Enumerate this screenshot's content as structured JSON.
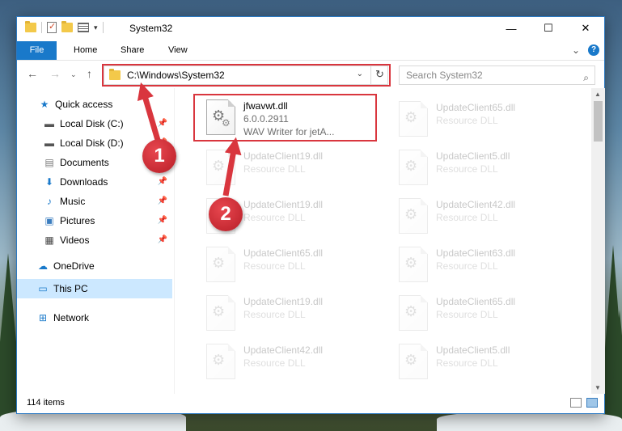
{
  "window": {
    "title": "System32",
    "controls": {
      "minimize": "—",
      "maximize": "☐",
      "close": "✕"
    }
  },
  "ribbon": {
    "tabs": [
      "File",
      "Home",
      "Share",
      "View"
    ],
    "expand": "⌄",
    "help": "?"
  },
  "address": {
    "path": "C:\\Windows\\System32",
    "search_placeholder": "Search System32"
  },
  "sidebar": {
    "items": [
      {
        "label": "Quick access",
        "icon": "star-icon"
      },
      {
        "label": "Local Disk (C:)",
        "icon": "drive-icon"
      },
      {
        "label": "Local Disk (D:)",
        "icon": "drive-icon"
      },
      {
        "label": "Documents",
        "icon": "document-icon"
      },
      {
        "label": "Downloads",
        "icon": "download-icon"
      },
      {
        "label": "Music",
        "icon": "music-icon"
      },
      {
        "label": "Pictures",
        "icon": "pictures-icon"
      },
      {
        "label": "Videos",
        "icon": "video-icon"
      },
      {
        "label": "OneDrive",
        "icon": "cloud-icon"
      },
      {
        "label": "This PC",
        "icon": "computer-icon"
      },
      {
        "label": "Network",
        "icon": "network-icon"
      }
    ]
  },
  "files": {
    "highlighted": {
      "name": "jfwavwt.dll",
      "version": "6.0.0.2911",
      "description": "WAV Writer for jetA..."
    },
    "left_column": [
      {
        "name": "UpdateClient19.dll",
        "sub": "Resource DLL"
      },
      {
        "name": "UpdateClient19.dll",
        "sub": "Resource DLL"
      },
      {
        "name": "UpdateClient65.dll",
        "sub": "Resource DLL"
      },
      {
        "name": "UpdateClient19.dll",
        "sub": "Resource DLL"
      },
      {
        "name": "UpdateClient42.dll",
        "sub": "Resource DLL"
      }
    ],
    "right_column": [
      {
        "name": "UpdateClient65.dll",
        "sub": "Resource DLL"
      },
      {
        "name": "UpdateClient5.dll",
        "sub": "Resource DLL"
      },
      {
        "name": "UpdateClient42.dll",
        "sub": "Resource DLL"
      },
      {
        "name": "UpdateClient63.dll",
        "sub": "Resource DLL"
      },
      {
        "name": "UpdateClient65.dll",
        "sub": "Resource DLL"
      },
      {
        "name": "UpdateClient5.dll",
        "sub": "Resource DLL"
      }
    ]
  },
  "status": {
    "count": "114 items"
  },
  "callouts": [
    "1",
    "2"
  ],
  "colors": {
    "accent": "#1979ca",
    "highlight": "#d9363e",
    "selected": "#cce8ff"
  }
}
